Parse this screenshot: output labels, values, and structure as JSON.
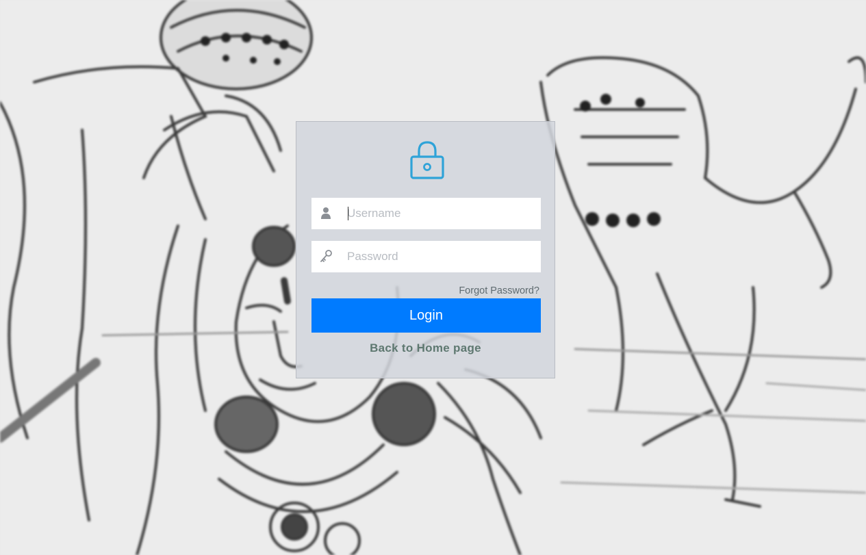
{
  "login": {
    "username_placeholder": "Username",
    "username_value": "",
    "password_placeholder": "Password",
    "password_value": "",
    "forgot_label": "Forgot Password?",
    "login_label": "Login",
    "back_label": "Back to Home page"
  },
  "icons": {
    "header": "lock-icon",
    "username": "user-icon",
    "password": "key-icon"
  },
  "colors": {
    "accent": "#007bff",
    "lock_icon": "#2fa3d8",
    "panel": "#d2d5dc",
    "link": "#5e7870"
  }
}
